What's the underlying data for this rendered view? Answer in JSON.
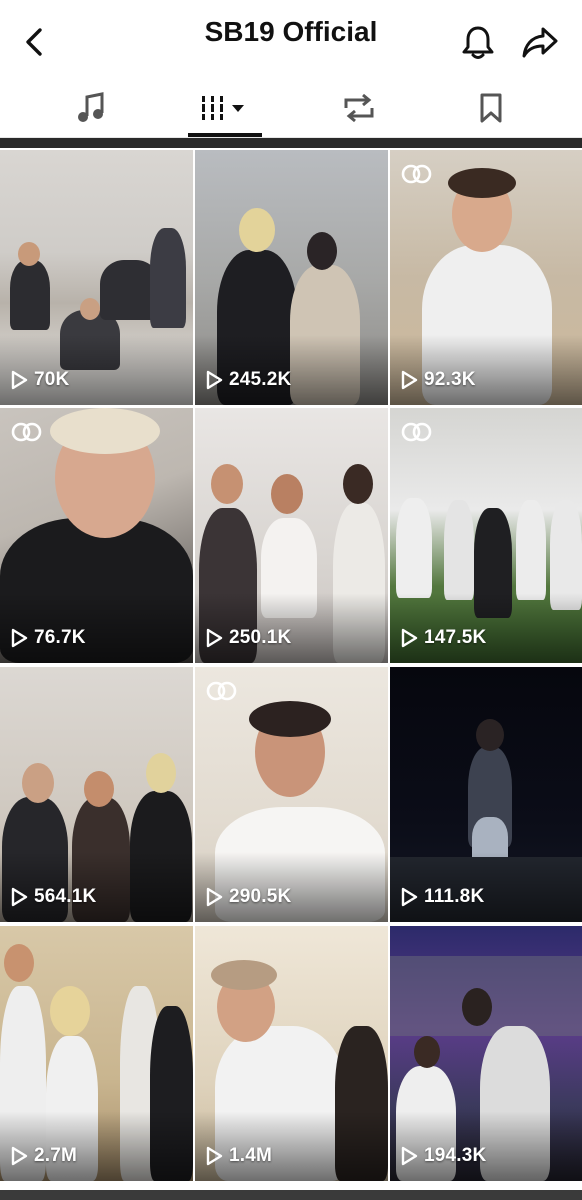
{
  "header": {
    "title": "SB19 Official",
    "back_icon": "chevron-left-icon",
    "bell_icon": "bell-icon",
    "share_icon": "share-arrow-icon"
  },
  "tabs": [
    {
      "icon": "music-note-icon",
      "active": false
    },
    {
      "icon": "grid-filter-icon",
      "active": true
    },
    {
      "icon": "repost-icon",
      "active": false
    },
    {
      "icon": "bookmark-icon",
      "active": false
    }
  ],
  "videos": [
    {
      "views": "70K",
      "collab": false
    },
    {
      "views": "245.2K",
      "collab": false
    },
    {
      "views": "92.3K",
      "collab": true
    },
    {
      "views": "76.7K",
      "collab": true
    },
    {
      "views": "250.1K",
      "collab": false
    },
    {
      "views": "147.5K",
      "collab": true
    },
    {
      "views": "564.1K",
      "collab": false
    },
    {
      "views": "290.5K",
      "collab": true
    },
    {
      "views": "111.8K",
      "collab": false
    },
    {
      "views": "2.7M",
      "collab": false
    },
    {
      "views": "1.4M",
      "collab": false
    },
    {
      "views": "194.3K",
      "collab": false
    }
  ],
  "colors": {
    "text": "#111111",
    "white": "#ffffff"
  }
}
